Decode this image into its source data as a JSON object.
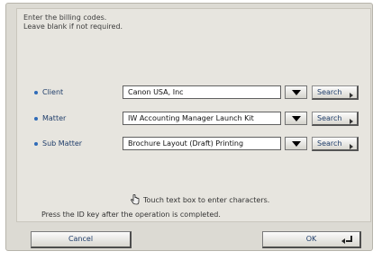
{
  "instructions": "Enter the billing codes.\nLeave blank if not required.",
  "fields": [
    {
      "label": "Client",
      "value": "Canon USA, Inc",
      "search_label": "Search"
    },
    {
      "label": "Matter",
      "value": "IW Accounting Manager Launch Kit",
      "search_label": "Search"
    },
    {
      "label": "Sub Matter",
      "value": "Brochure Layout (Draft) Printing",
      "search_label": "Search"
    }
  ],
  "hint": "Touch text box to enter characters.",
  "status": "Press the ID key after the operation is completed.",
  "buttons": {
    "cancel": "Cancel",
    "ok": "OK"
  },
  "icons": {
    "hint": "hand-pointer-icon",
    "dropdown": "dropdown-arrow-icon",
    "search_arrow": "chevron-right-icon",
    "ok_arrow": "enter-arrow-icon"
  },
  "colors": {
    "label": "#1f3d6a",
    "bullet": "#2f6bb8",
    "panel_bg": "#e7e5df"
  }
}
